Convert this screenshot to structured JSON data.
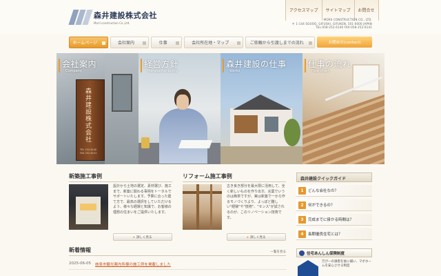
{
  "header": {
    "logo_jp": "森井建設株式会社",
    "logo_en": "Morii construction Co.,Ltd.",
    "top_links": [
      "アクセスマップ",
      "サイトマップ",
      "お問合せ"
    ],
    "company_info": [
      "MORII CONSTRUCTION CO., LTD.",
      "〒 1-144 SOUOO, GIFUSHI, GIFUKEN, 501-0000 JAPAN",
      "TEL:058-252-6140 FAX:058-252-6141"
    ]
  },
  "nav": {
    "items": [
      "ホームページ",
      "会社案内",
      "仕事",
      "会社所在地・マップ",
      "ご依頼から引渡しまでの流れ"
    ],
    "contact": "お問合せ(contact)"
  },
  "hero": [
    {
      "title": "会社案内",
      "sub": "Company"
    },
    {
      "title": "経営方針",
      "sub": "Managerial policy"
    },
    {
      "title": "森井建設の仕事",
      "sub": "Works"
    },
    {
      "title": "仕事の流れ",
      "sub": "Flow chart"
    }
  ],
  "sign": {
    "text": "森井建設株式会社",
    "tel": "TEL 252-6140\nFAX 252-6141"
  },
  "new_works": {
    "title": "新築施工事例",
    "desc": "設計から土地の選定、素材選び、施工まで、新築に関わる事柄をトータルでサポートいたします。予算に合った建て方で、最高の選択をしていただけるよう、様々な経験と知識で、お客様の理想の住まいをご提供いたします。",
    "more": "詳しく見る"
  },
  "reform_works": {
    "title": "リフォーム施工事例",
    "desc": "古き良き部分を最大限に活用して、全く新しいものを作り出す。言葉でいうのは簡単ですが、実は新築で一から作るモノづくりより、よっぽど難しい\"経験\"や\"技術\"、\"センス\"が試されるのが、このリノベーション技術です。",
    "more": "詳しく見る"
  },
  "news": {
    "title": "新着情報",
    "all": "一覧を見る",
    "items": [
      {
        "date": "2025-06-05",
        "text": "岐阜市観光案内所棟の施工例を掲載しました"
      }
    ]
  },
  "guide": {
    "title": "森井建設クイックガイド",
    "items": [
      {
        "num": "1",
        "label": "どんな会社なの？"
      },
      {
        "num": "2",
        "label": "何ができるの？"
      },
      {
        "num": "3",
        "label": "完成までに掛かる時間は？"
      },
      {
        "num": "4",
        "label": "長期優良住宅とは？"
      }
    ]
  },
  "safety": {
    "title": "住宅あんしん保険制度",
    "text": "万が一の損害を後に補い、マボホームを安心させる制度"
  },
  "colors": {
    "accent": "#e8982e",
    "brand": "#2b3c5c",
    "link": "#c9531b"
  }
}
